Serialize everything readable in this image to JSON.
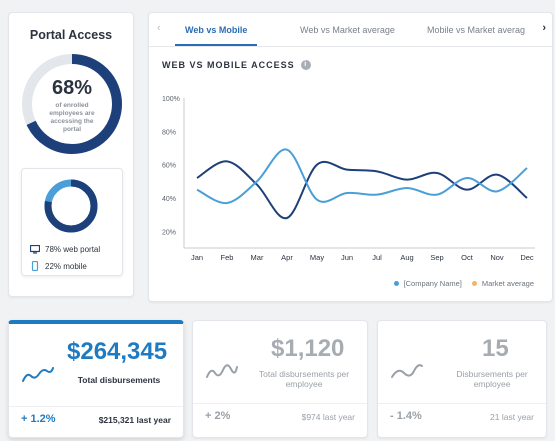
{
  "portal": {
    "title": "Portal Access",
    "percent": "68%",
    "percent_value": 0.68,
    "subtitle": "of enrolled employees are accessing the portal",
    "web_fraction": 0.78,
    "web_label": "78% web portal",
    "mobile_label": "22% mobile",
    "icons": [
      "monitor-icon",
      "phone-icon"
    ]
  },
  "tabs": {
    "items": [
      "Web vs Mobile",
      "Web vs Market average",
      "Mobile vs Market averag"
    ],
    "active_index": 0,
    "prev_icon": "chevron-left-icon",
    "next_icon": "chevron-right-icon"
  },
  "chart": {
    "heading": "WEB VS MOBILE ACCESS",
    "info_icon": "info-icon",
    "legend": [
      "[Company Name]",
      "Market average"
    ],
    "legend_colors": [
      "#4a9fd8",
      "#f5b26b"
    ]
  },
  "chart_data": {
    "type": "line",
    "categories": [
      "Jan",
      "Feb",
      "Mar",
      "Apr",
      "May",
      "Jun",
      "Jul",
      "Aug",
      "Sep",
      "Oct",
      "Nov",
      "Dec"
    ],
    "yticks": [
      "100%",
      "80%",
      "60%",
      "40%",
      "20%"
    ],
    "ylim": [
      10,
      100
    ],
    "series": [
      {
        "values": [
          52,
          62,
          48,
          28,
          60,
          57,
          56,
          51,
          55,
          45,
          54,
          40
        ],
        "color": "#1d3f7a"
      },
      {
        "values": [
          45,
          37,
          50,
          69,
          39,
          43,
          42,
          46,
          42,
          52,
          44,
          58
        ],
        "color": "#4a9fd8"
      }
    ]
  },
  "stats": [
    {
      "value": "$264,345",
      "label": "Total disbursements",
      "change": "+ 1.2%",
      "last": "$215,321 last year",
      "icon": "trend-icon",
      "highlight": true
    },
    {
      "value": "$1,120",
      "label": "Total disbursements per employee",
      "change": "+ 2%",
      "last": "$974 last year",
      "icon": "trend-icon",
      "highlight": false
    },
    {
      "value": "15",
      "label": "Disbursements per employee",
      "change": "- 1.4%",
      "last": "21 last year",
      "icon": "trend-icon",
      "highlight": false
    }
  ],
  "colors": {
    "dark_blue": "#1d3f7a",
    "accent_blue": "#1f7bc1",
    "light_blue": "#4a9fd8",
    "donut_track": "#e3e6ea",
    "muted_text": "#9aa0a8"
  }
}
